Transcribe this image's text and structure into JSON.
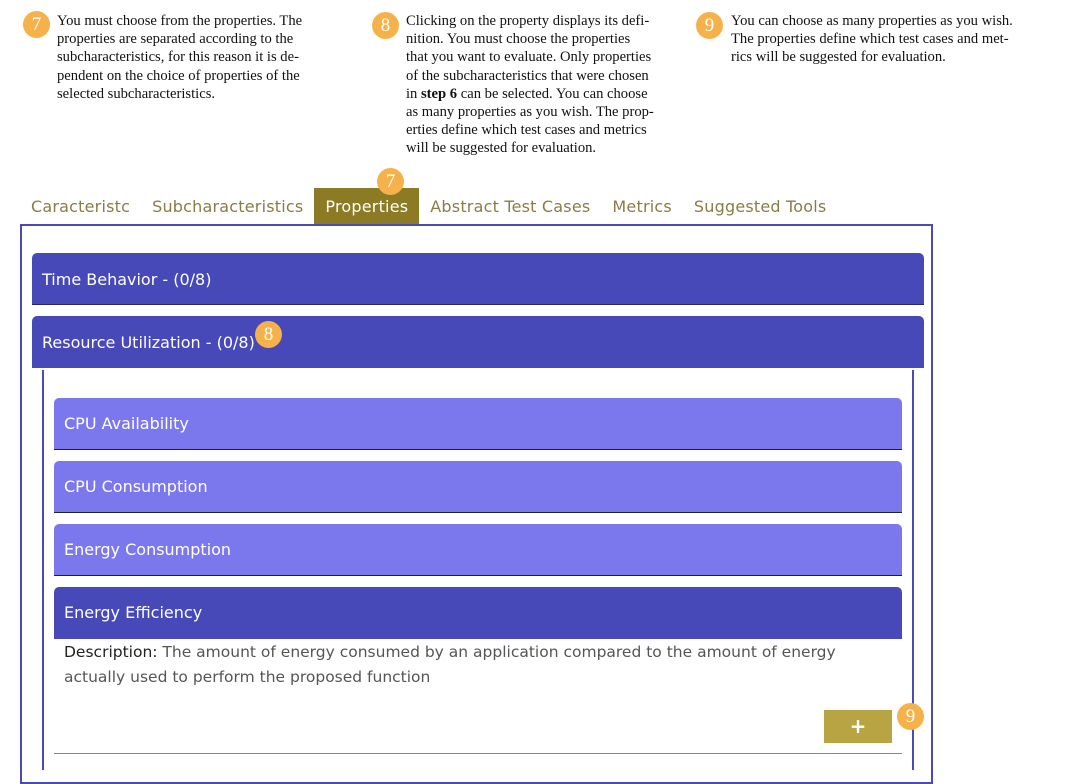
{
  "notes": [
    {
      "badge": "7",
      "lines": [
        "You must choose from the properties.  The",
        "properties are separated according to the",
        "subcharacteristics, for this reason it is de-",
        "pendent on the choice of properties of the",
        "selected subcharacteristics."
      ]
    },
    {
      "badge": "8",
      "line1": "Clicking on the property displays its defi-",
      "line2": "nition. You must choose the properties",
      "line3": "that you want to evaluate. Only properties",
      "line4": "of the subcharacteristics that were chosen",
      "line5_pre": "in ",
      "line5_bold": "step 6",
      "line5_post": " can be selected. You can choose",
      "line6": "as many properties as you wish. The prop-",
      "line7": "erties define which test cases and metrics",
      "line8": "will be suggested for evaluation."
    },
    {
      "badge": "9",
      "lines": [
        "You can choose as many properties as you wish.",
        "The properties define which test cases and met-",
        "rics will be suggested for evaluation."
      ]
    }
  ],
  "tabs": [
    "Caracteristc",
    "Subcharacteristics",
    "Properties",
    "Abstract Test Cases",
    "Metrics",
    "Suggested Tools"
  ],
  "tab_badge": "7",
  "subcharacteristics": [
    {
      "label": "Time Behavior - (0/8)"
    },
    {
      "label": "Resource Utilization - (0/8)",
      "badge": "8"
    }
  ],
  "properties": [
    "CPU Availability",
    "CPU Consumption",
    "Energy Consumption",
    "Energy Efficiency"
  ],
  "description": {
    "label": "Description:",
    "line1": " The amount of energy consumed by an application compared to the amount of energy",
    "line2": "actually used to perform the proposed function"
  },
  "add_button": {
    "label": "+",
    "badge": "9"
  },
  "colors": {
    "badge": "#f6b24a",
    "tab_active": "#8c7b24",
    "header": "#4749b8",
    "property": "#7b78ee",
    "add_button": "#b8a443"
  }
}
